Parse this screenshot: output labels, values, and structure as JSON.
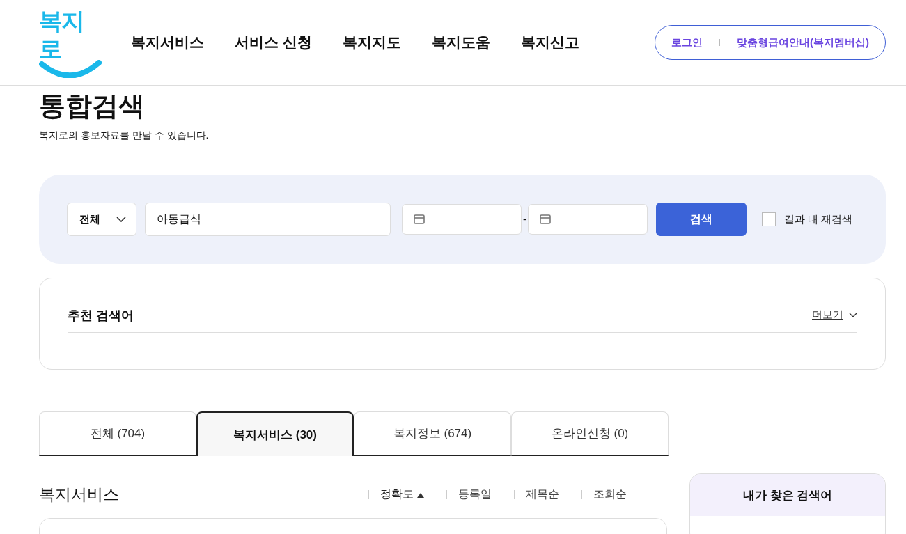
{
  "header": {
    "logo": "복지로",
    "nav": [
      "복지서비스",
      "서비스 신청",
      "복지지도",
      "복지도움",
      "복지신고"
    ],
    "links": [
      "로그인",
      "맞춤형급여안내(복지멤버십)"
    ]
  },
  "page": {
    "title": "통합검색",
    "subtitle": "복지로의 홍보자료를 만날 수 있습니다."
  },
  "search": {
    "category": "전체",
    "query": "아동급식",
    "date_separator": "-",
    "button": "검색",
    "research": {
      "label": "결과 내 재검색",
      "checked": false
    }
  },
  "recommend": {
    "title": "추천 검색어",
    "more": "더보기",
    "expanded": false
  },
  "tabs": [
    {
      "label": "전체  (704)",
      "selected": false
    },
    {
      "label": "복지서비스 (30)",
      "selected": true
    },
    {
      "label": "복지정보 (674)",
      "selected": false
    },
    {
      "label": "온라인신청 (0)",
      "selected": false
    }
  ],
  "section": {
    "title": "복지서비스",
    "sorts": [
      {
        "label": "정확도",
        "selected": true
      },
      {
        "label": "등록일",
        "selected": false
      },
      {
        "label": "제목순",
        "selected": false
      },
      {
        "label": "조회순",
        "selected": false
      }
    ]
  },
  "sidebar": {
    "title": "내가 찾은 검색어"
  }
}
